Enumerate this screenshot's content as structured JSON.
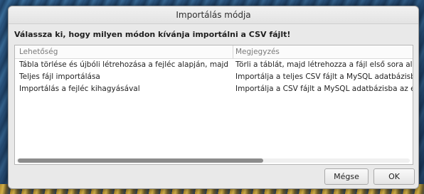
{
  "dialog": {
    "title": "Importálás módja",
    "prompt": "Válassza ki, hogy milyen módon kívánja importálni a CSV fájlt!"
  },
  "list": {
    "columns": [
      "Lehetőség",
      "Megjegyzés"
    ],
    "rows": [
      {
        "option": "Tábla törlése és újbóli létrehozása a fejléc alapján, majd importálás",
        "note": "Törli a táblát, majd létrehozza a fájl első sora alapján szer"
      },
      {
        "option": "Teljes fájl importálása",
        "note": "Importálja a teljes CSV fájlt a MySQL adatbázisba"
      },
      {
        "option": "Importálás a fejléc kihagyásával",
        "note": "Importálja a CSV fájlt a MySQL adatbázisba az első sor k"
      }
    ]
  },
  "buttons": {
    "cancel": "Mégse",
    "ok": "OK"
  }
}
